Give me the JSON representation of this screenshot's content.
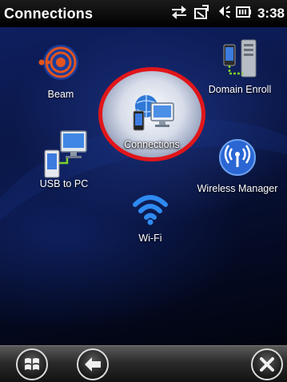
{
  "statusbar": {
    "title": "Connections",
    "time": "3:38",
    "icons": [
      "data-transfer-icon",
      "no-signal-icon",
      "speaker-icon",
      "battery-icon"
    ]
  },
  "apps": {
    "beam": {
      "label": "Beam",
      "icon": "beam-icon"
    },
    "domain_enroll": {
      "label": "Domain Enroll",
      "icon": "domain-enroll-icon"
    },
    "connections": {
      "label": "Connections",
      "icon": "connections-icon"
    },
    "usb_to_pc": {
      "label": "USB to PC",
      "icon": "usb-to-pc-icon"
    },
    "wireless_manager": {
      "label": "Wireless Manager",
      "icon": "wireless-manager-icon"
    },
    "wifi": {
      "label": "Wi-Fi",
      "icon": "wifi-icon"
    }
  },
  "taskbar": {
    "buttons": [
      "windows-start-icon",
      "back-arrow-icon",
      "close-icon"
    ]
  },
  "colors": {
    "highlight_ring": "#e0161a",
    "wallpaper_blue": "#0e1f5f",
    "beam_orange": "#e2551f"
  }
}
